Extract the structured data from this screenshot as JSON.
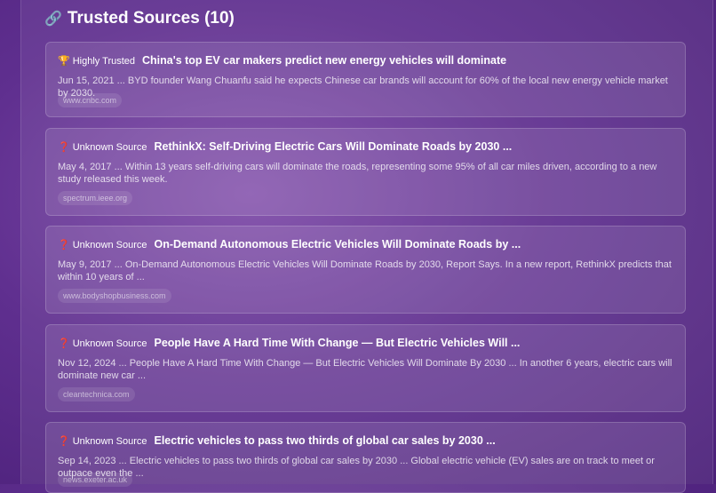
{
  "header": {
    "icon": "link-icon",
    "title": "Trusted Sources (10)"
  },
  "sources": [
    {
      "badge_icon": "trophy-icon",
      "badge_glyph": "🏆",
      "badge": "Highly Trusted",
      "title": "China's top EV car makers predict new energy vehicles will dominate",
      "snippet": "Jun 15, 2021 ... BYD founder Wang Chuanfu said he expects Chinese car brands will account for 60% of the local new energy vehicle market by 2030.",
      "domain": "www.cnbc.com"
    },
    {
      "badge_icon": "question-icon",
      "badge_glyph": "❓",
      "badge": "Unknown Source",
      "title": "RethinkX: Self-Driving Electric Cars Will Dominate Roads by 2030 ...",
      "snippet": "May 4, 2017 ... Within 13 years self-driving cars will dominate the roads, representing some 95% of all car miles driven, according to a new study released this week.",
      "domain": "spectrum.ieee.org"
    },
    {
      "badge_icon": "question-icon",
      "badge_glyph": "❓",
      "badge": "Unknown Source",
      "title": "On-Demand Autonomous Electric Vehicles Will Dominate Roads by ...",
      "snippet": "May 9, 2017 ... On-Demand Autonomous Electric Vehicles Will Dominate Roads by 2030, Report Says. In a new report, RethinkX predicts that within 10 years of ...",
      "domain": "www.bodyshopbusiness.com"
    },
    {
      "badge_icon": "question-icon",
      "badge_glyph": "❓",
      "badge": "Unknown Source",
      "title": "People Have A Hard Time With Change — But Electric Vehicles Will ...",
      "snippet": "Nov 12, 2024 ... People Have A Hard Time With Change — But Electric Vehicles Will Dominate By 2030 ... In another 6 years, electric cars will dominate new car ...",
      "domain": "cleantechnica.com"
    },
    {
      "badge_icon": "question-icon",
      "badge_glyph": "❓",
      "badge": "Unknown Source",
      "title": "Electric vehicles to pass two thirds of global car sales by 2030 ...",
      "snippet": "Sep 14, 2023 ... Electric vehicles to pass two thirds of global car sales by 2030 ... Global electric vehicle (EV) sales are on track to meet or outpace even the ...",
      "domain": "news.exeter.ac.uk"
    }
  ]
}
